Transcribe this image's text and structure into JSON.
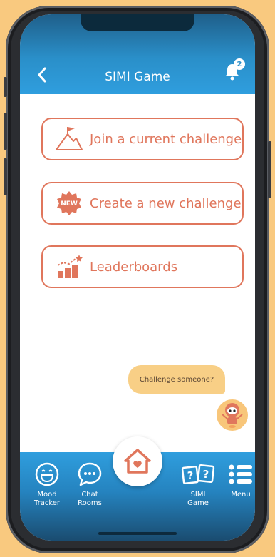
{
  "header": {
    "title": "SIMI Game",
    "notification_count": "2"
  },
  "cards": [
    {
      "label": "Join a current challenge",
      "icon": "flag-mountain-icon"
    },
    {
      "label": "Create a new challenge",
      "icon": "new-badge-icon",
      "badge_text": "NEW"
    },
    {
      "label": "Leaderboards",
      "icon": "leaderboard-chart-icon"
    }
  ],
  "assistant": {
    "prompt": "Challenge someone?",
    "icon": "robot-mascot-icon"
  },
  "bottom_nav": {
    "items": [
      {
        "label": "Mood\nTracker",
        "icon": "mood-face-icon"
      },
      {
        "label": "Chat\nRooms",
        "icon": "chat-bubble-icon"
      },
      {
        "label": "SIMI\nGame",
        "icon": "question-cards-icon"
      },
      {
        "label": "Menu",
        "icon": "menu-list-icon"
      }
    ],
    "home_icon": "home-heart-icon"
  },
  "colors": {
    "accent": "#e0765c",
    "primary_blue": "#2a8fc9",
    "bubble": "#F8CF86",
    "background": "#F9C97F"
  }
}
